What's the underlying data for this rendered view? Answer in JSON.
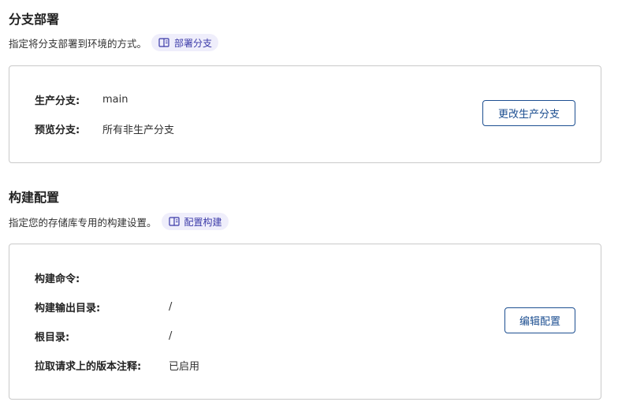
{
  "branch_section": {
    "title": "分支部署",
    "description": "指定将分支部署到环境的方式。",
    "doc_link": {
      "icon": "book-icon",
      "label": "部署分支"
    },
    "rows": [
      {
        "label": "生产分支:",
        "value": "main"
      },
      {
        "label": "预览分支:",
        "value": "所有非生产分支"
      }
    ],
    "button_label": "更改生产分支"
  },
  "build_section": {
    "title": "构建配置",
    "description": "指定您的存储库专用的构建设置。",
    "doc_link": {
      "icon": "book-icon",
      "label": "配置构建"
    },
    "rows": [
      {
        "label": "构建命令:",
        "value": ""
      },
      {
        "label": "构建输出目录:",
        "value": "/"
      },
      {
        "label": "根目录:",
        "value": "/"
      },
      {
        "label": "拉取请求上的版本注释:",
        "value": "已启用"
      }
    ],
    "button_label": "编辑配置"
  },
  "colors": {
    "accent": "#1d4f91",
    "pill_bg": "#efeefb",
    "pill_text": "#3b3aa8",
    "border": "#c9c9c9"
  }
}
